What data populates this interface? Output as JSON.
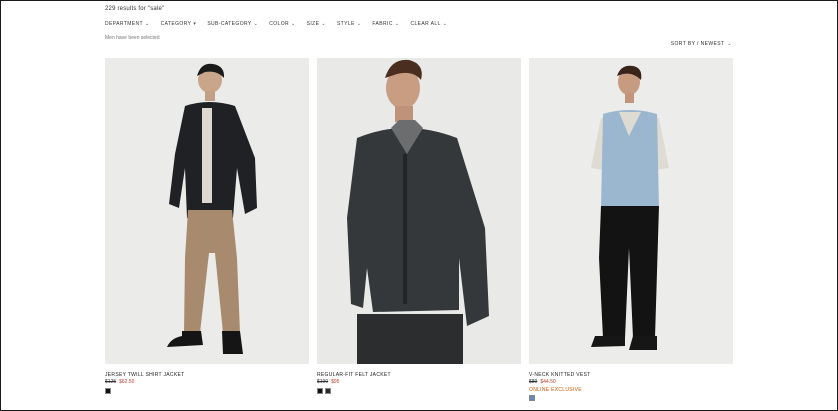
{
  "header": {
    "results_text": "229 results for \"sale\"",
    "selected_text": "Men have been selected",
    "sort_label": "SORT BY / NEWEST"
  },
  "filters": [
    {
      "label": "DEPARTMENT"
    },
    {
      "label": "CATEGORY"
    },
    {
      "label": "SUB-CATEGORY"
    },
    {
      "label": "COLOR"
    },
    {
      "label": "SIZE"
    },
    {
      "label": "STYLE"
    },
    {
      "label": "FABRIC"
    },
    {
      "label": "CLEAR ALL"
    }
  ],
  "products": [
    {
      "name": "JERSEY TWILL SHIRT JACKET",
      "old_price": "$125",
      "new_price": "$62.50",
      "swatches": [
        "#111111"
      ]
    },
    {
      "name": "REGULAR-FIT FELT JACKET",
      "old_price": "$190",
      "new_price": "$95",
      "swatches": [
        "#111111",
        "#2b2b2b"
      ]
    },
    {
      "name": "V-NECK KNITTED VEST",
      "old_price": "$89",
      "new_price": "$44.50",
      "badge": "ONLINE EXCLUSIVE",
      "swatches": [
        "#6a87ad"
      ]
    }
  ],
  "icons": {
    "chevron": "chevron-down-icon"
  }
}
